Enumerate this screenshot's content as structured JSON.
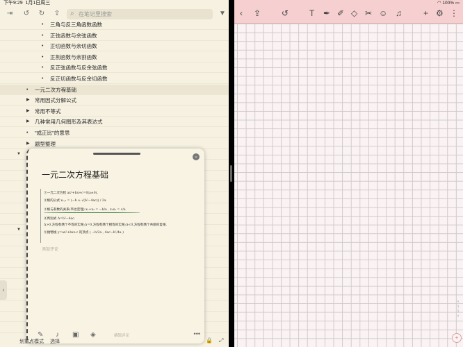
{
  "status_left": {
    "time": "下午9:29",
    "date": "1月1日周三"
  },
  "toolbar_left": {
    "search_placeholder": "在笔记里搜索"
  },
  "outline_rows": [
    {
      "label": "三角与反三角函数函数",
      "indent": 3,
      "kind": "bullet"
    },
    {
      "label": "正弦函数与余弦函数",
      "indent": 3,
      "kind": "bullet"
    },
    {
      "label": "正切函数与余切函数",
      "indent": 3,
      "kind": "bullet"
    },
    {
      "label": "正割函数与余割函数",
      "indent": 3,
      "kind": "bullet"
    },
    {
      "label": "反正弦函数与反余弦函数",
      "indent": 3,
      "kind": "bullet"
    },
    {
      "label": "反正切函数与反余切函数",
      "indent": 3,
      "kind": "bullet"
    },
    {
      "label": "一元二次方程基础",
      "indent": 2,
      "kind": "bullet",
      "selected": true
    },
    {
      "label": "常用因式分解公式",
      "indent": 2,
      "kind": "collapsed"
    },
    {
      "label": "常用不等式",
      "indent": 2,
      "kind": "collapsed"
    },
    {
      "label": "几种常用几何图形及其表达式",
      "indent": 2,
      "kind": "collapsed"
    },
    {
      "label": "\"成正比\"的意思",
      "indent": 2,
      "kind": "bullet"
    },
    {
      "label": "题型整理",
      "indent": 2,
      "kind": "collapsed"
    }
  ],
  "card": {
    "title": "一元二次方程基础",
    "formula_lines": [
      "①一元二次方程   ax²+bx+c=0(a≠0).",
      "②根的公式   x₁,₂ = (−b ± √(b²−4ac)) / 2a",
      "③根与系数的关系(韦达定理) x₁+x₂ = −b/a , x₁x₂ = c/a",
      "④判别式   Δ=b²−4ac.",
      "Δ>0,方程有两个不等的实根;Δ=0,方程有两个相等的实根;Δ<0,方程有两个共轭的复根.",
      "⑤抛物线 y=ax²+bx+c 的顶点 ( −b/2a , 4ac−b²/4a )"
    ],
    "comment_placeholder": "添加评论",
    "edit_hint": "编辑评论"
  },
  "bottom_left": {
    "mode_label": "划重点模式",
    "select_label": "选择"
  },
  "status_right": {
    "battery": "100%"
  },
  "pager": {
    "page": "1",
    "total": "1"
  },
  "colors": {
    "left_bg": "#f6f1e1",
    "right_header": "#f6d0d0",
    "grid": "#cfcaca"
  }
}
